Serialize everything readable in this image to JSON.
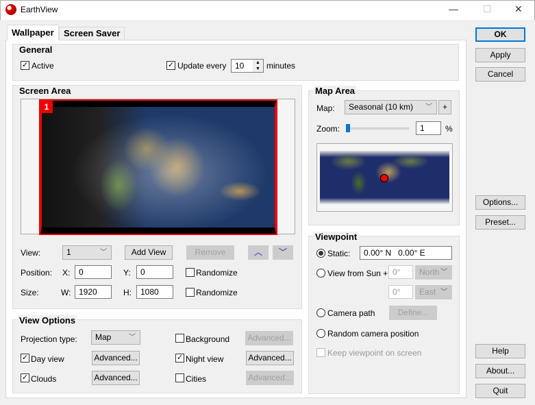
{
  "window": {
    "title": "EarthView",
    "minimize": "—",
    "maximize": "☐",
    "close": "✕"
  },
  "tabs": [
    {
      "label": "Wallpaper",
      "active": true
    },
    {
      "label": "Screen Saver",
      "active": false
    }
  ],
  "general": {
    "title": "General",
    "active_label": "Active",
    "active_checked": true,
    "update_label": "Update every",
    "update_checked": true,
    "update_value": "10",
    "minutes_label": "minutes"
  },
  "screen_area": {
    "title": "Screen Area",
    "view_badge": "1",
    "view_label": "View:",
    "view_value": "1",
    "add_view": "Add View",
    "remove": "Remove",
    "position_label": "Position:",
    "x_label": "X:",
    "x_value": "0",
    "y_label": "Y:",
    "y_value": "0",
    "randomize_pos": "Randomize",
    "size_label": "Size:",
    "w_label": "W:",
    "w_value": "1920",
    "h_label": "H:",
    "h_value": "1080",
    "randomize_size": "Randomize"
  },
  "view_options": {
    "title": "View Options",
    "projection_label": "Projection type:",
    "projection_value": "Map",
    "background_label": "Background",
    "background_checked": false,
    "day_label": "Day view",
    "day_checked": true,
    "night_label": "Night view",
    "night_checked": true,
    "clouds_label": "Clouds",
    "clouds_checked": true,
    "cities_label": "Cities",
    "cities_checked": false,
    "advanced": "Advanced..."
  },
  "map_area": {
    "title": "Map Area",
    "map_label": "Map:",
    "map_value": "Seasonal (10 km)",
    "plus": "+",
    "zoom_label": "Zoom:",
    "zoom_value": "1",
    "zoom_unit": "%",
    "zoom_percent": 1,
    "accent": "#0078d7"
  },
  "viewpoint": {
    "title": "Viewpoint",
    "static_label": "Static:",
    "static_value": "0.00° N   0.00° E",
    "sun_label": "View from Sun +",
    "sun_lat": "0°",
    "sun_lat_dir": "North",
    "sun_lon": "0°",
    "sun_lon_dir": "East",
    "camera_label": "Camera path",
    "define": "Define...",
    "random_label": "Random camera position",
    "keep_label": "Keep viewpoint on screen",
    "selected": "static"
  },
  "buttons": {
    "ok": "OK",
    "apply": "Apply",
    "cancel": "Cancel",
    "options": "Options...",
    "preset": "Preset...",
    "help": "Help",
    "about": "About...",
    "quit": "Quit"
  }
}
